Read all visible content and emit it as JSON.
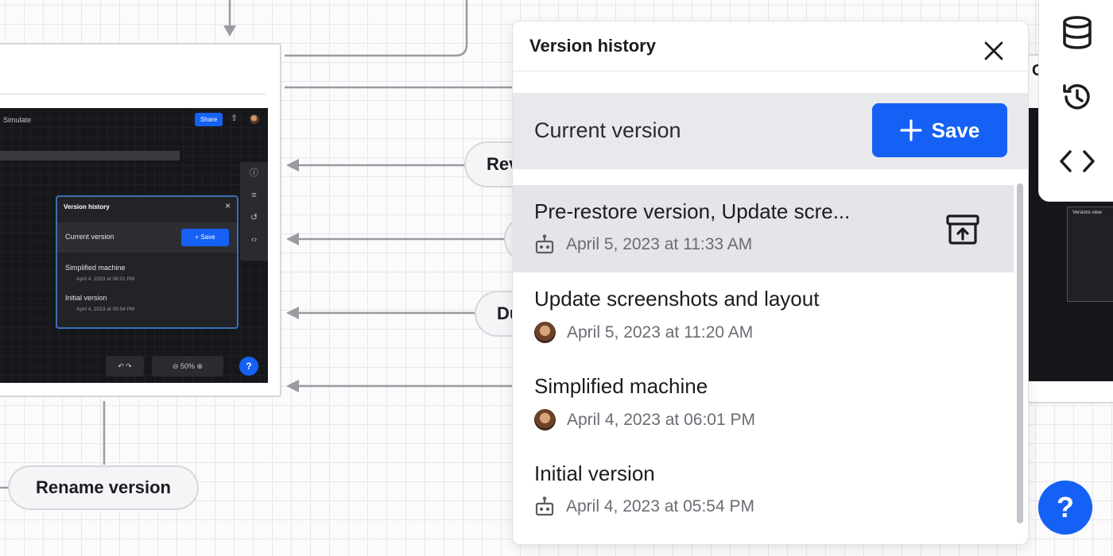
{
  "canvas": {
    "pills": {
      "rename": "Rename version",
      "revert_partial": "Rev",
      "duplicate_partial": "Du",
      "right_partial": "C"
    }
  },
  "mini_screenshot": {
    "title": "Simulate",
    "share_label": "Share",
    "panel_title": "Version history",
    "current_label": "Current version",
    "save_label": "Save",
    "items": [
      {
        "title": "Simplified machine",
        "date": "April 4, 2023 at 06:01 PM"
      },
      {
        "title": "Initial version",
        "date": "April 4, 2023 at 05:54 PM"
      }
    ],
    "zoom": "50%",
    "help": "?"
  },
  "right_mini": {
    "title": "Versions view"
  },
  "toolbar": {
    "items": [
      {
        "icon": "database-icon"
      },
      {
        "icon": "history-icon"
      },
      {
        "icon": "code-icon"
      }
    ]
  },
  "version_history": {
    "title": "Version history",
    "current_label": "Current version",
    "save_label": "Save",
    "items": [
      {
        "title": "Pre-restore version, Update scre...",
        "date": "April 5, 2023 at 11:33 AM",
        "author": "bot-icon",
        "selected": true
      },
      {
        "title": "Update screenshots and layout",
        "date": "April 5, 2023 at 11:20 AM",
        "author": "avatar"
      },
      {
        "title": "Simplified machine",
        "date": "April 4, 2023 at 06:01 PM",
        "author": "avatar"
      },
      {
        "title": "Initial version",
        "date": "April 4, 2023 at 05:54 PM",
        "author": "bot-icon"
      }
    ]
  },
  "help": {
    "label": "?"
  },
  "colors": {
    "accent": "#1561f5",
    "panel_bg": "#ffffff",
    "selected_row": "#e4e5e9",
    "current_row": "#e8e9ed",
    "canvas_bg": "#fbfbfc"
  }
}
